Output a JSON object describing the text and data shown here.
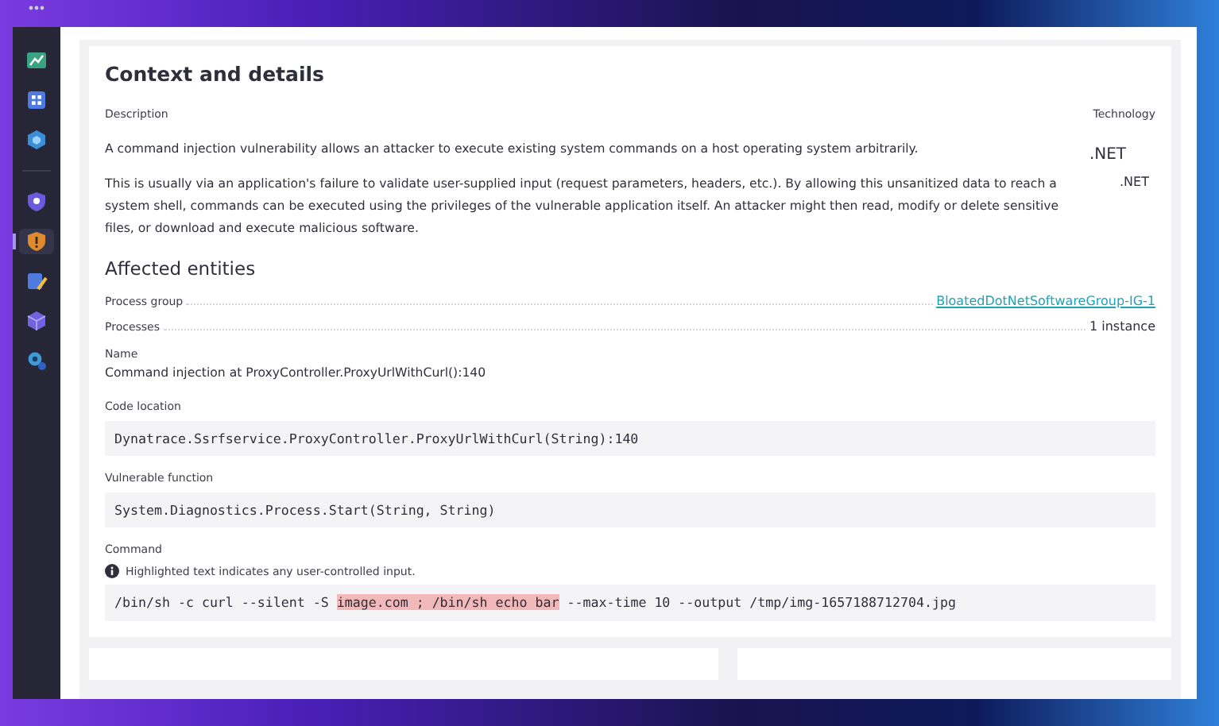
{
  "sidebar": {
    "items": [
      {
        "selected": false
      },
      {
        "selected": false
      },
      {
        "selected": false
      },
      {
        "selected": false
      },
      {
        "selected": true
      },
      {
        "selected": false
      },
      {
        "selected": false
      },
      {
        "selected": false
      }
    ]
  },
  "details": {
    "title": "Context and details",
    "description_label": "Description",
    "technology_label": "Technology",
    "rows": [
      {
        "text": "A command injection vulnerability allows an attacker to execute existing system commands on a host operating system arbitrarily.",
        "technology": ".NET"
      },
      {
        "text": "This is usually via an application's failure to validate user-supplied input (request parameters, headers, etc.). By allowing this unsanitized data to reach a system shell, commands can be executed using the privileges of the vulnerable application itself. An attacker might then read, modify or delete sensitive files, or download and execute malicious software.",
        "technology": ".NET"
      }
    ]
  },
  "affected_entities": {
    "title": "Affected entities",
    "properties": [
      {
        "label": "Process group",
        "value": "BloatedDotNetSoftwareGroup-IG-1",
        "kind": "link"
      },
      {
        "label": "Processes",
        "value": "1 instance",
        "kind": "text"
      }
    ],
    "name_label": "Name",
    "name": "Command injection at ProxyController.ProxyUrlWithCurl():140",
    "code_location_label": "Code location",
    "code_location": "Dynatrace.Ssrfservice.ProxyController.ProxyUrlWithCurl(String):140",
    "vulnerable_function_label": "Vulnerable function",
    "vulnerable_function": "System.Diagnostics.Process.Start(String, String)",
    "command_label": "Command",
    "command_hint": "Highlighted text indicates any user-controlled input.",
    "command": [
      {
        "text": "/bin/sh -c curl --silent -S ",
        "highlighted": false
      },
      {
        "text": "image.com ; /bin/sh echo bar",
        "highlighted": true
      },
      {
        "text": " --max-time 10 --output /tmp/img-1657188712704.jpg",
        "highlighted": false
      }
    ]
  }
}
